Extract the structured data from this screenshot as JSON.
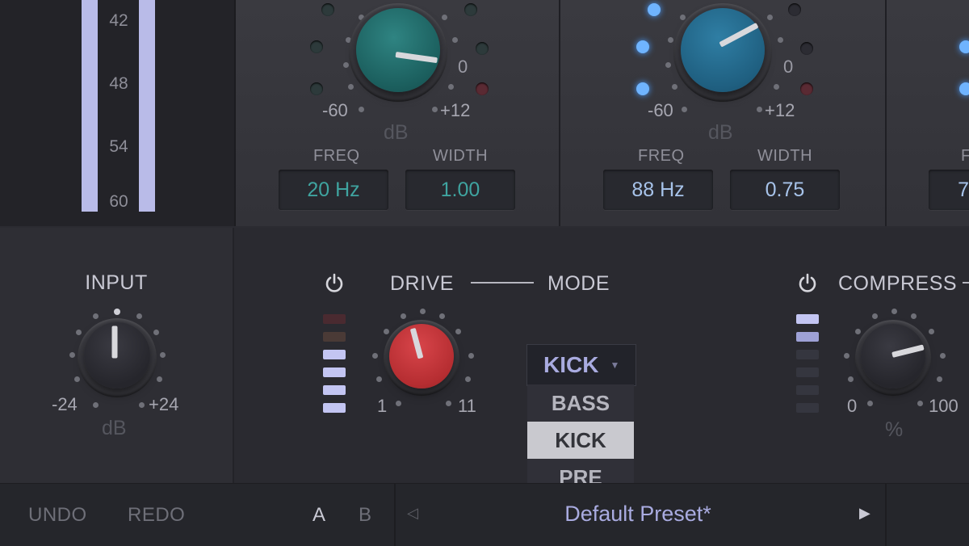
{
  "meter": {
    "scale": [
      "42",
      "48",
      "54",
      "60"
    ]
  },
  "bands": [
    {
      "range_min": "-60",
      "range_max": "+12",
      "zero": "0",
      "unit": "dB",
      "freq_label": "FREQ",
      "width_label": "WIDTH",
      "freq_value": "20 Hz",
      "width_value": "1.00",
      "accent": "#1f6e6d",
      "value_color": "#3fa4a0"
    },
    {
      "range_min": "-60",
      "range_max": "+12",
      "zero": "0",
      "unit": "dB",
      "freq_label": "FREQ",
      "width_label": "WIDTH",
      "freq_value": "88 Hz",
      "width_value": "0.75",
      "accent": "#2a6a8c",
      "value_color": "#a7c3ea"
    }
  ],
  "band3": {
    "freq_label_partial": "F",
    "freq_value_partial": "7"
  },
  "input": {
    "title": "INPUT",
    "min": "-24",
    "max": "+24",
    "unit": "dB"
  },
  "drive": {
    "title": "DRIVE",
    "mode_title": "MODE",
    "min": "1",
    "max": "11",
    "knob_color": "#c63638"
  },
  "mode_dropdown": {
    "selected": "KICK",
    "options": [
      "BASS",
      "KICK",
      "PRE"
    ]
  },
  "compress": {
    "title": "COMPRESS",
    "min": "0",
    "max": "100",
    "unit": "%"
  },
  "footer": {
    "undo": "UNDO",
    "redo": "REDO",
    "a": "A",
    "b": "B",
    "preset": "Default Preset*"
  },
  "colors": {
    "accent_lilac": "#b9bbe8",
    "panel": "#2b2b31"
  }
}
